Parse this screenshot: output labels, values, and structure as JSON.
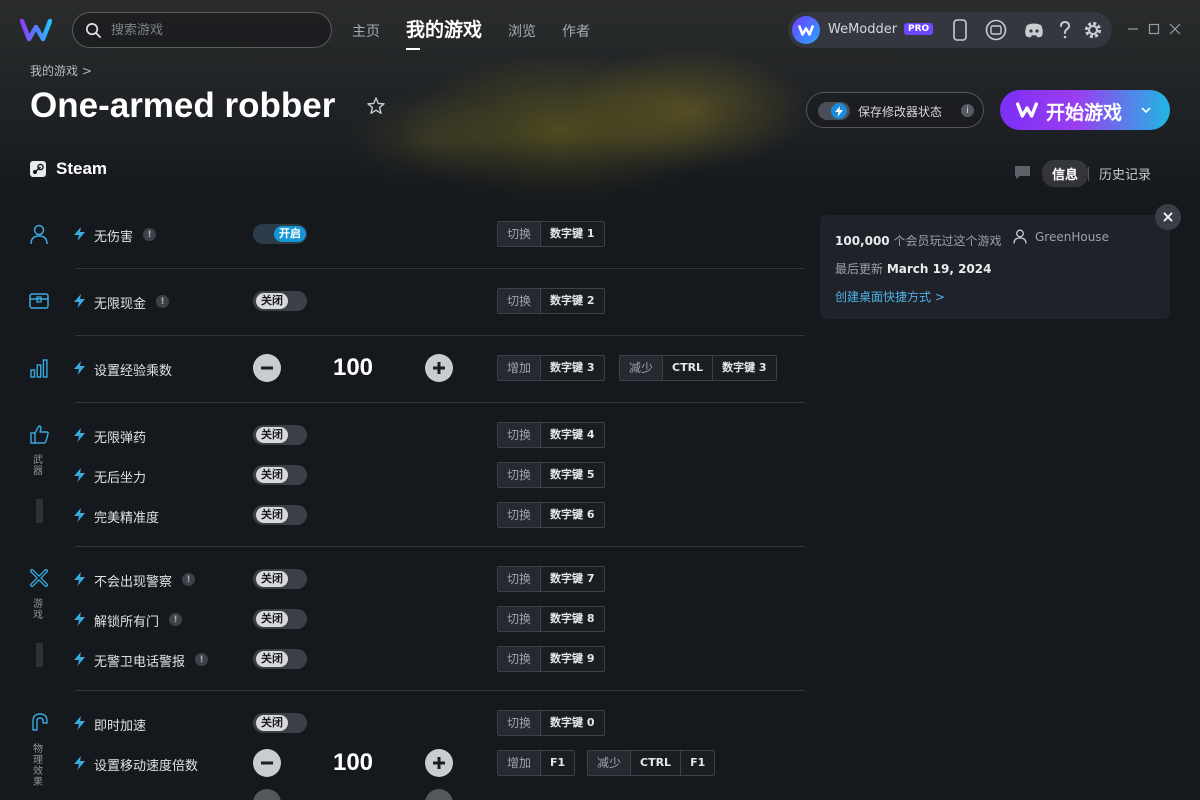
{
  "app": {
    "name": "WeModder",
    "badge": "PRO"
  },
  "search": {
    "placeholder": "搜索游戏"
  },
  "nav": {
    "home": "主页",
    "my_games": "我的游戏",
    "browse": "浏览",
    "authors": "作者"
  },
  "breadcrumb": "我的游戏 >",
  "game": {
    "title": "One-armed robber",
    "platform": "Steam"
  },
  "save_mods": {
    "label": "保存修改器状态"
  },
  "play": {
    "label": "开始游戏"
  },
  "tabs": {
    "info": "信息",
    "history": "历史记录"
  },
  "card": {
    "members_count": "100,000",
    "members_text": "个会员玩过这个游戏",
    "creator": "GreenHouse",
    "updated_label": "最后更新",
    "updated_date": "March 19, 2024",
    "shortcut_link": "创建桌面快捷方式 >"
  },
  "categories": {
    "weapons": "武器",
    "game": "游戏",
    "physics": "物理效果"
  },
  "cheats": [
    {
      "name": "无伤害",
      "state": "开启",
      "action": "切换",
      "key": "数字键 1"
    },
    {
      "name": "无限现金",
      "state": "关闭",
      "action": "切换",
      "key": "数字键 2"
    },
    {
      "name": "设置经验乘数",
      "value": "100",
      "inc_action": "增加",
      "inc_key": "数字键 3",
      "dec_action": "减少",
      "dec_mod": "CTRL",
      "dec_key": "数字键 3"
    },
    {
      "name": "无限弹药",
      "state": "关闭",
      "action": "切换",
      "key": "数字键 4"
    },
    {
      "name": "无后坐力",
      "state": "关闭",
      "action": "切换",
      "key": "数字键 5"
    },
    {
      "name": "完美精准度",
      "state": "关闭",
      "action": "切换",
      "key": "数字键 6"
    },
    {
      "name": "不会出现警察",
      "state": "关闭",
      "action": "切换",
      "key": "数字键 7"
    },
    {
      "name": "解锁所有门",
      "state": "关闭",
      "action": "切换",
      "key": "数字键 8"
    },
    {
      "name": "无警卫电话警报",
      "state": "关闭",
      "action": "切换",
      "key": "数字键 9"
    },
    {
      "name": "即时加速",
      "state": "关闭",
      "action": "切换",
      "key": "数字键 0"
    },
    {
      "name": "设置移动速度倍数",
      "value": "100",
      "inc_action": "增加",
      "inc_key": "F1",
      "dec_action": "减少",
      "dec_mod": "CTRL",
      "dec_key": "F1"
    }
  ],
  "colors": {
    "accent": "#1796d6",
    "play_start": "#7b2ff7",
    "play_end": "#1fb7e4",
    "pro": "#6e46ff"
  }
}
